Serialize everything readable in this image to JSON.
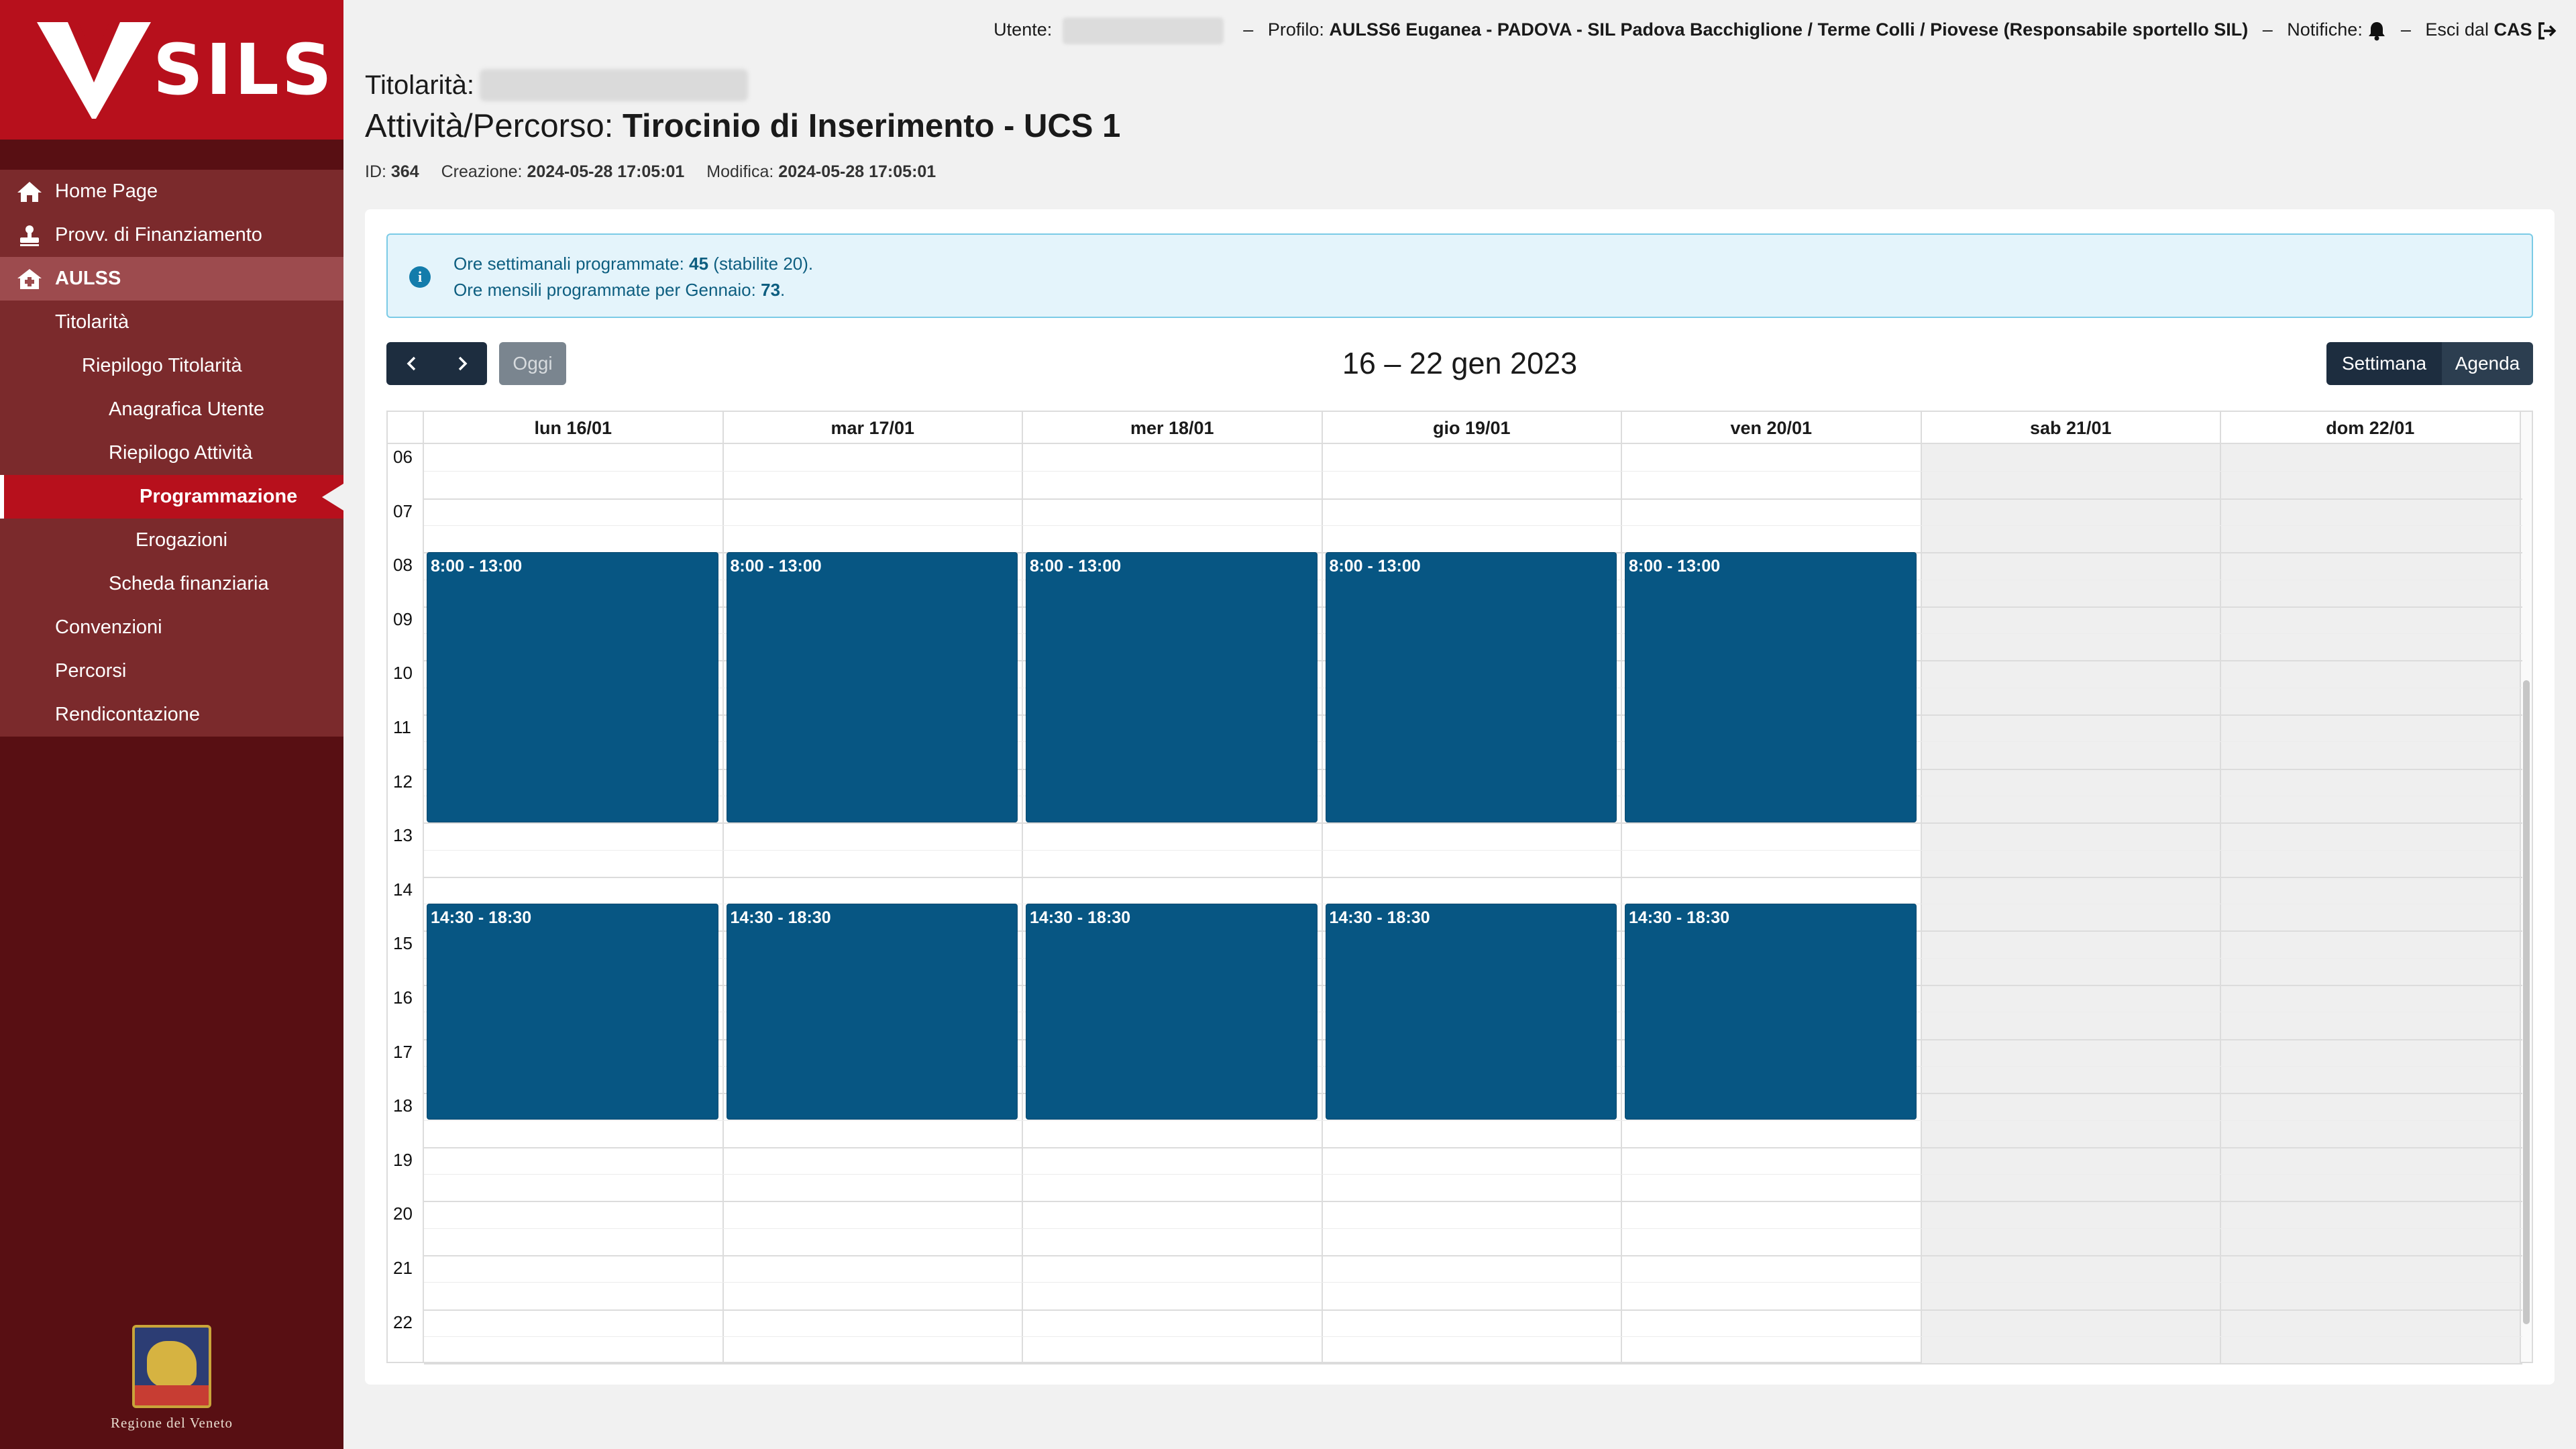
{
  "logo": {
    "text": "SILS"
  },
  "sidebar": {
    "items": [
      {
        "label": "Home Page",
        "icon": "home-icon",
        "level": 0
      },
      {
        "label": "Provv. di Finanziamento",
        "icon": "stamp-icon",
        "level": 0
      },
      {
        "label": "AULSS",
        "icon": "hospital-icon",
        "level": 0
      },
      {
        "label": "Titolarità",
        "level": 1
      },
      {
        "label": "Riepilogo Titolarità",
        "level": 2
      },
      {
        "label": "Anagrafica Utente",
        "level": 3
      },
      {
        "label": "Riepilogo Attività",
        "level": 3
      },
      {
        "label": "Programmazione",
        "level": 4
      },
      {
        "label": "Erogazioni",
        "level": 4
      },
      {
        "label": "Scheda finanziaria",
        "level": 3
      },
      {
        "label": "Convenzioni",
        "level": 1
      },
      {
        "label": "Percorsi",
        "level": 1
      },
      {
        "label": "Rendicontazione",
        "level": 1
      }
    ],
    "footer": "Regione del Veneto"
  },
  "topbar": {
    "user_label": "Utente:",
    "profile_label": "Profilo:",
    "profile_value": "AULSS6 Euganea - PADOVA - SIL Padova Bacchiglione / Terme Colli / Piovese (Responsabile sportello SIL)",
    "notifications_label": "Notifiche:",
    "logout_label": "Esci dal",
    "logout_bold": "CAS"
  },
  "header": {
    "titolarita_label": "Titolarità:",
    "attivita_label": "Attività/Percorso:",
    "attivita_value": "Tirocinio di Inserimento - UCS 1",
    "id_label": "ID:",
    "id_value": "364",
    "creazione_label": "Creazione:",
    "creazione_value": "2024-05-28 17:05:01",
    "modifica_label": "Modifica:",
    "modifica_value": "2024-05-28 17:05:01"
  },
  "info": {
    "line1_prefix": "Ore settimanali programmate:",
    "line1_value": "45",
    "line1_suffix": "(stabilite 20).",
    "line2_prefix": "Ore mensili programmate per Gennaio:",
    "line2_value": "73",
    "line2_suffix": "."
  },
  "toolbar": {
    "today_label": "Oggi",
    "range": "16 – 22 gen 2023",
    "view_week": "Settimana",
    "view_agenda": "Agenda"
  },
  "calendar": {
    "days": [
      "lun 16/01",
      "mar 17/01",
      "mer 18/01",
      "gio 19/01",
      "ven 20/01",
      "sab 21/01",
      "dom 22/01"
    ],
    "hours": [
      "06",
      "07",
      "08",
      "09",
      "10",
      "11",
      "12",
      "13",
      "14",
      "15",
      "16",
      "17",
      "18",
      "19",
      "20",
      "21",
      "22"
    ],
    "events": [
      {
        "day": 0,
        "label": "8:00 - 13:00",
        "start": 8,
        "end": 13
      },
      {
        "day": 1,
        "label": "8:00 - 13:00",
        "start": 8,
        "end": 13
      },
      {
        "day": 2,
        "label": "8:00 - 13:00",
        "start": 8,
        "end": 13
      },
      {
        "day": 3,
        "label": "8:00 - 13:00",
        "start": 8,
        "end": 13
      },
      {
        "day": 4,
        "label": "8:00 - 13:00",
        "start": 8,
        "end": 13
      },
      {
        "day": 0,
        "label": "14:30 - 18:30",
        "start": 14.5,
        "end": 18.5
      },
      {
        "day": 1,
        "label": "14:30 - 18:30",
        "start": 14.5,
        "end": 18.5
      },
      {
        "day": 2,
        "label": "14:30 - 18:30",
        "start": 14.5,
        "end": 18.5
      },
      {
        "day": 3,
        "label": "14:30 - 18:30",
        "start": 14.5,
        "end": 18.5
      },
      {
        "day": 4,
        "label": "14:30 - 18:30",
        "start": 14.5,
        "end": 18.5
      }
    ]
  },
  "colors": {
    "brand_red": "#b7101c",
    "sidebar_dark": "#580f13",
    "event_blue": "#075683",
    "toolbar_dark": "#1d2d3f"
  }
}
